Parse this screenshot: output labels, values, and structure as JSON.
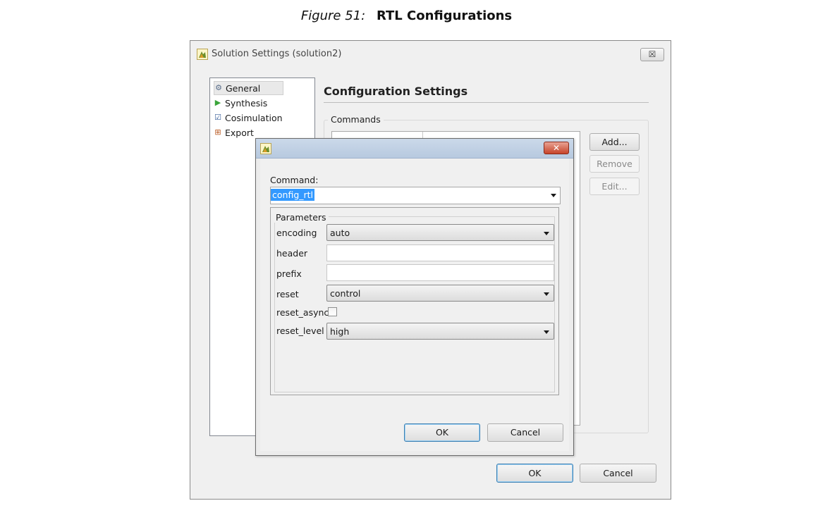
{
  "caption": {
    "number": "Figure 51:",
    "title": "RTL Configurations"
  },
  "window": {
    "title": "Solution Settings (solution2)",
    "close_label": "☒",
    "nav": [
      {
        "icon": "general-icon",
        "glyph": "⚙",
        "label": "General"
      },
      {
        "icon": "synthesis-icon",
        "glyph": "▶",
        "label": "Synthesis"
      },
      {
        "icon": "cosimulation-icon",
        "glyph": "☑",
        "label": "Cosimulation"
      },
      {
        "icon": "export-icon",
        "glyph": "⊞",
        "label": "Export"
      }
    ],
    "section_title": "Configuration Settings",
    "commands_label": "Commands",
    "buttons": {
      "add": "Add...",
      "remove": "Remove",
      "edit": "Edit...",
      "ok": "OK",
      "cancel": "Cancel"
    }
  },
  "dialog": {
    "close_label": "✕",
    "command_label": "Command:",
    "command_value": "config_rtl",
    "parameters_label": "Parameters",
    "params": {
      "encoding": {
        "label": "encoding",
        "value": "auto"
      },
      "header": {
        "label": "header",
        "value": ""
      },
      "prefix": {
        "label": "prefix",
        "value": ""
      },
      "reset": {
        "label": "reset",
        "value": "control"
      },
      "reset_async": {
        "label": "reset_async",
        "checked": false
      },
      "reset_level": {
        "label": "reset_level",
        "value": "high"
      }
    },
    "buttons": {
      "ok": "OK",
      "cancel": "Cancel"
    }
  },
  "colors": {
    "selection": "#3399ff",
    "dialog_close": "#c7442a",
    "default_button_border": "#3c7fb1"
  }
}
